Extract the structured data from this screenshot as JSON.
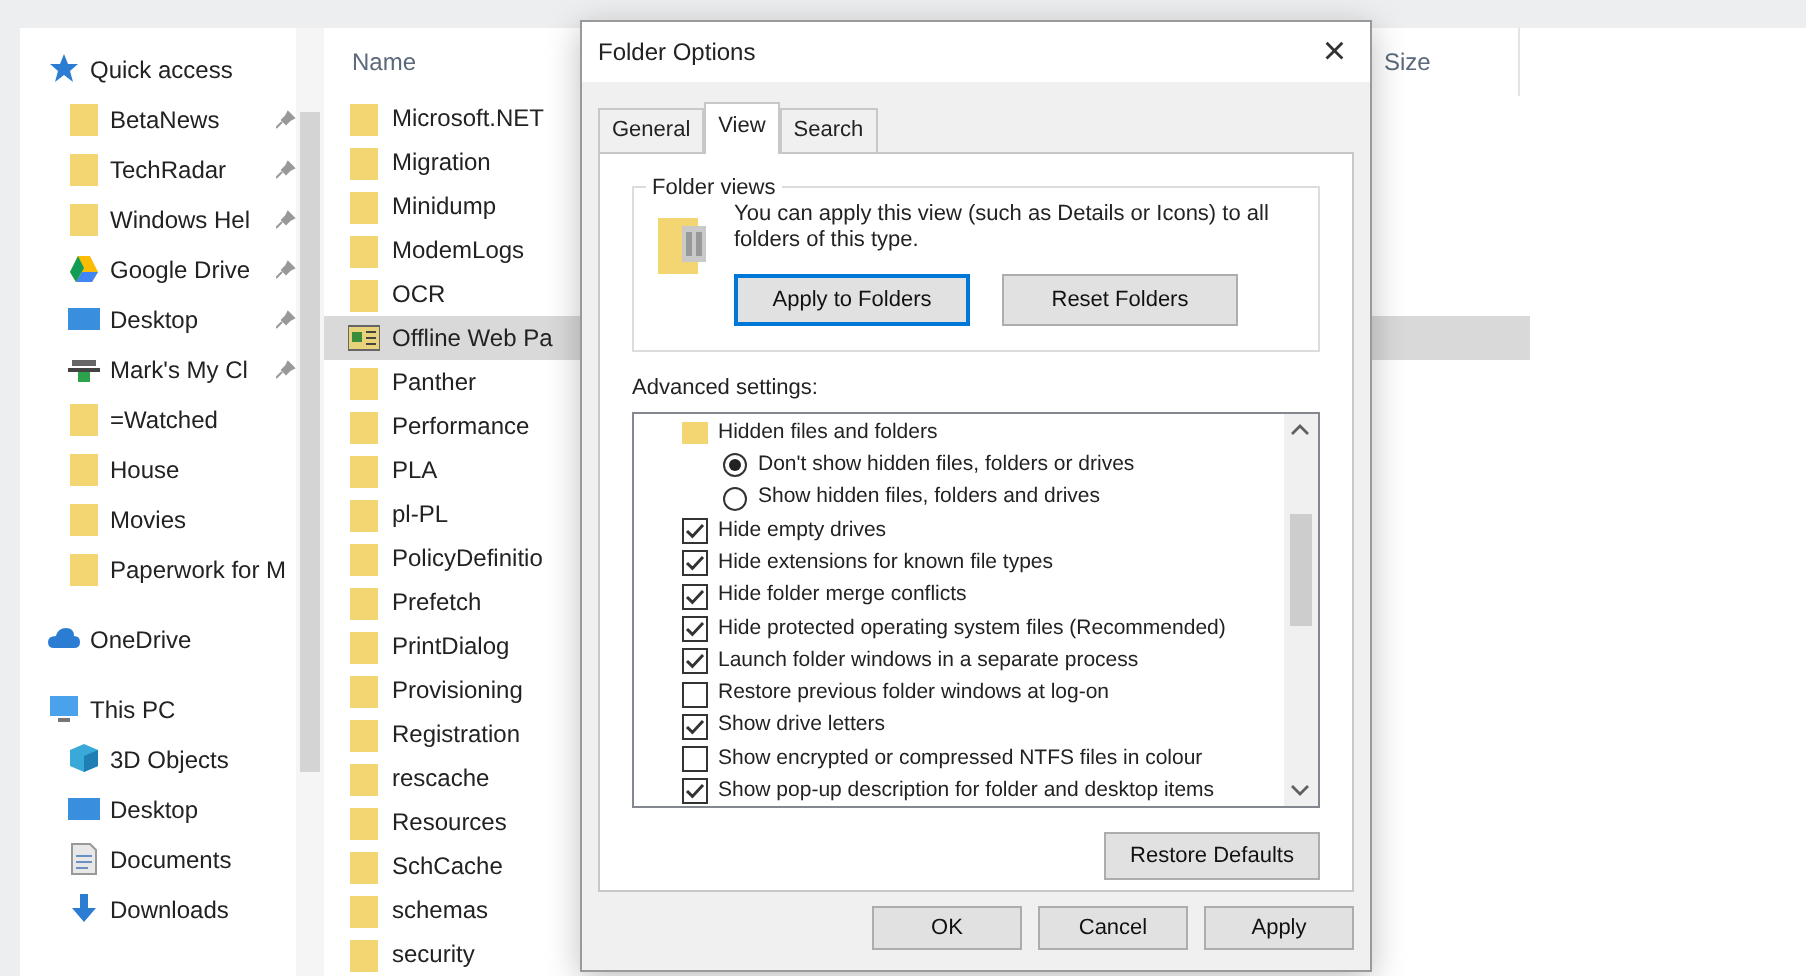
{
  "navigation": [
    {
      "label": "Quick access",
      "kind": "star",
      "pinned": false,
      "indent": false
    },
    {
      "label": "BetaNews",
      "kind": "folder",
      "pinned": true,
      "indent": true
    },
    {
      "label": "TechRadar",
      "kind": "folder",
      "pinned": true,
      "indent": true
    },
    {
      "label": "Windows Hel",
      "kind": "folder",
      "pinned": true,
      "indent": true
    },
    {
      "label": "Google Drive",
      "kind": "drive",
      "pinned": true,
      "indent": true
    },
    {
      "label": "Desktop",
      "kind": "desktop",
      "pinned": true,
      "indent": true
    },
    {
      "label": "Mark's My Cl",
      "kind": "network",
      "pinned": true,
      "indent": true
    },
    {
      "label": "=Watched",
      "kind": "folder",
      "pinned": false,
      "indent": true
    },
    {
      "label": "House",
      "kind": "folder",
      "pinned": false,
      "indent": true
    },
    {
      "label": "Movies",
      "kind": "folder",
      "pinned": false,
      "indent": true
    },
    {
      "label": "Paperwork for M",
      "kind": "folder",
      "pinned": false,
      "indent": true
    },
    {
      "label": "OneDrive",
      "kind": "cloud",
      "pinned": false,
      "indent": false
    },
    {
      "label": "This PC",
      "kind": "pc",
      "pinned": false,
      "indent": false
    },
    {
      "label": "3D Objects",
      "kind": "cube",
      "pinned": false,
      "indent": true
    },
    {
      "label": "Desktop",
      "kind": "desktop",
      "pinned": false,
      "indent": true
    },
    {
      "label": "Documents",
      "kind": "document",
      "pinned": false,
      "indent": true
    },
    {
      "label": "Downloads",
      "kind": "download",
      "pinned": false,
      "indent": true
    }
  ],
  "file_list": {
    "columns": [
      "Name",
      "Size"
    ],
    "rows": [
      {
        "name": "Microsoft.NET",
        "kind": "folder",
        "selected": false
      },
      {
        "name": "Migration",
        "kind": "folder",
        "selected": false
      },
      {
        "name": "Minidump",
        "kind": "folder",
        "selected": false
      },
      {
        "name": "ModemLogs",
        "kind": "folder",
        "selected": false
      },
      {
        "name": "OCR",
        "kind": "folder",
        "selected": false
      },
      {
        "name": "Offline Web Pa",
        "kind": "web",
        "selected": true
      },
      {
        "name": "Panther",
        "kind": "folder",
        "selected": false
      },
      {
        "name": "Performance",
        "kind": "folder",
        "selected": false
      },
      {
        "name": "PLA",
        "kind": "folder",
        "selected": false
      },
      {
        "name": "pl-PL",
        "kind": "folder",
        "selected": false
      },
      {
        "name": "PolicyDefinitio",
        "kind": "folder",
        "selected": false
      },
      {
        "name": "Prefetch",
        "kind": "folder",
        "selected": false
      },
      {
        "name": "PrintDialog",
        "kind": "folder",
        "selected": false
      },
      {
        "name": "Provisioning",
        "kind": "folder",
        "selected": false
      },
      {
        "name": "Registration",
        "kind": "folder",
        "selected": false
      },
      {
        "name": "rescache",
        "kind": "folder",
        "selected": false
      },
      {
        "name": "Resources",
        "kind": "folder",
        "selected": false
      },
      {
        "name": "SchCache",
        "kind": "folder",
        "selected": false
      },
      {
        "name": "schemas",
        "kind": "folder",
        "selected": false
      },
      {
        "name": "security",
        "kind": "folder",
        "selected": false
      }
    ]
  },
  "dialog": {
    "title": "Folder Options",
    "close": "×",
    "tabs": [
      {
        "label": "General",
        "selected": false
      },
      {
        "label": "View",
        "selected": true
      },
      {
        "label": "Search",
        "selected": false
      }
    ],
    "folder_views": {
      "legend": "Folder views",
      "description": "You can apply this view (such as Details or Icons) to all folders of this type.",
      "buttons": [
        {
          "label": "Apply to Folders",
          "focused": true
        },
        {
          "label": "Reset Folders",
          "focused": false
        }
      ]
    },
    "advanced_label": "Advanced settings:",
    "advanced_settings": [
      {
        "kind": "folder",
        "label": "Hidden files and folders",
        "children": [
          {
            "kind": "radio",
            "label": "Don't show hidden files, folders or drives",
            "selected": true
          },
          {
            "kind": "radio",
            "label": "Show hidden files, folders and drives",
            "selected": false
          }
        ]
      },
      {
        "kind": "checkbox",
        "label": "Hide empty drives",
        "checked": true
      },
      {
        "kind": "checkbox",
        "label": "Hide extensions for known file types",
        "checked": true
      },
      {
        "kind": "checkbox",
        "label": "Hide folder merge conflicts",
        "checked": true
      },
      {
        "kind": "checkbox",
        "label": "Hide protected operating system files (Recommended)",
        "checked": true
      },
      {
        "kind": "checkbox",
        "label": "Launch folder windows in a separate process",
        "checked": true
      },
      {
        "kind": "checkbox",
        "label": "Restore previous folder windows at log-on",
        "checked": false
      },
      {
        "kind": "checkbox",
        "label": "Show drive letters",
        "checked": true
      },
      {
        "kind": "checkbox",
        "label": "Show encrypted or compressed NTFS files in colour",
        "checked": false
      },
      {
        "kind": "checkbox",
        "label": "Show pop-up description for folder and desktop items",
        "checked": true
      }
    ],
    "restore_button": "Restore Defaults",
    "footer_buttons": [
      "OK",
      "Cancel",
      "Apply"
    ]
  }
}
